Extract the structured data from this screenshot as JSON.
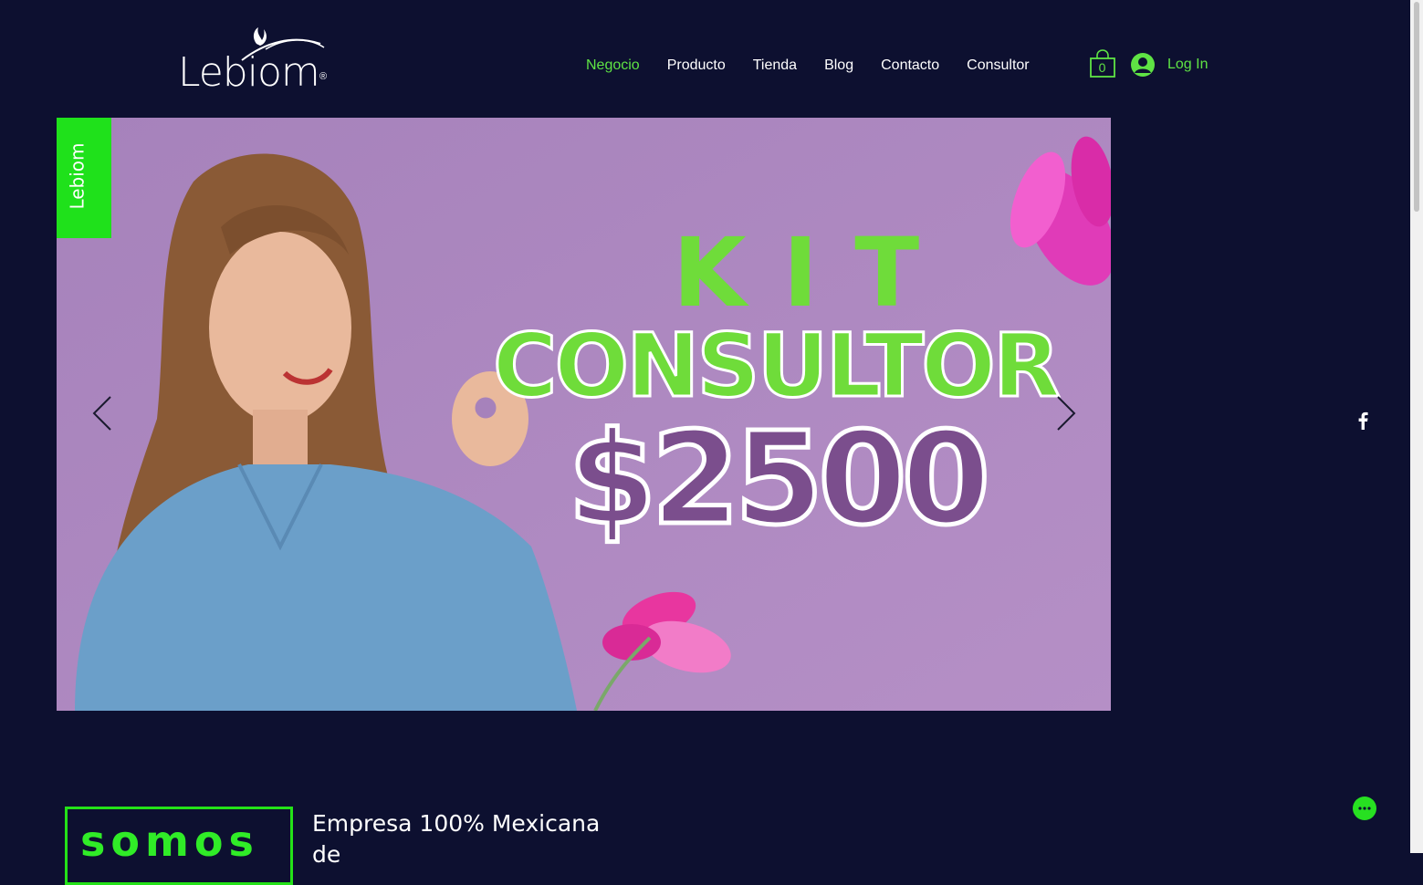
{
  "brand": {
    "name": "Lebiom",
    "registered": "®"
  },
  "nav": {
    "items": [
      {
        "label": "Negocio",
        "active": true
      },
      {
        "label": "Producto"
      },
      {
        "label": "Tienda"
      },
      {
        "label": "Blog"
      },
      {
        "label": "Contacto"
      },
      {
        "label": "Consultor"
      }
    ]
  },
  "cart": {
    "count": "0"
  },
  "login": {
    "label": "Log In"
  },
  "slider": {
    "brand_tag": "Lebiom",
    "headline_1": "KIT",
    "headline_2": "CONSULTOR",
    "price": "$2500"
  },
  "about": {
    "title": "somos",
    "text": "Empresa 100% Mexicana de"
  },
  "colors": {
    "background": "#0d1030",
    "accent": "#5fe344",
    "brand_green": "#1fe11b",
    "slide_purple": "#ac86bd"
  },
  "icons": {
    "cart": "shopping-bag-icon",
    "user": "user-avatar-icon",
    "prev": "chevron-left-icon",
    "next": "chevron-right-icon",
    "social": "facebook-icon",
    "chat": "chat-bubble-icon"
  }
}
